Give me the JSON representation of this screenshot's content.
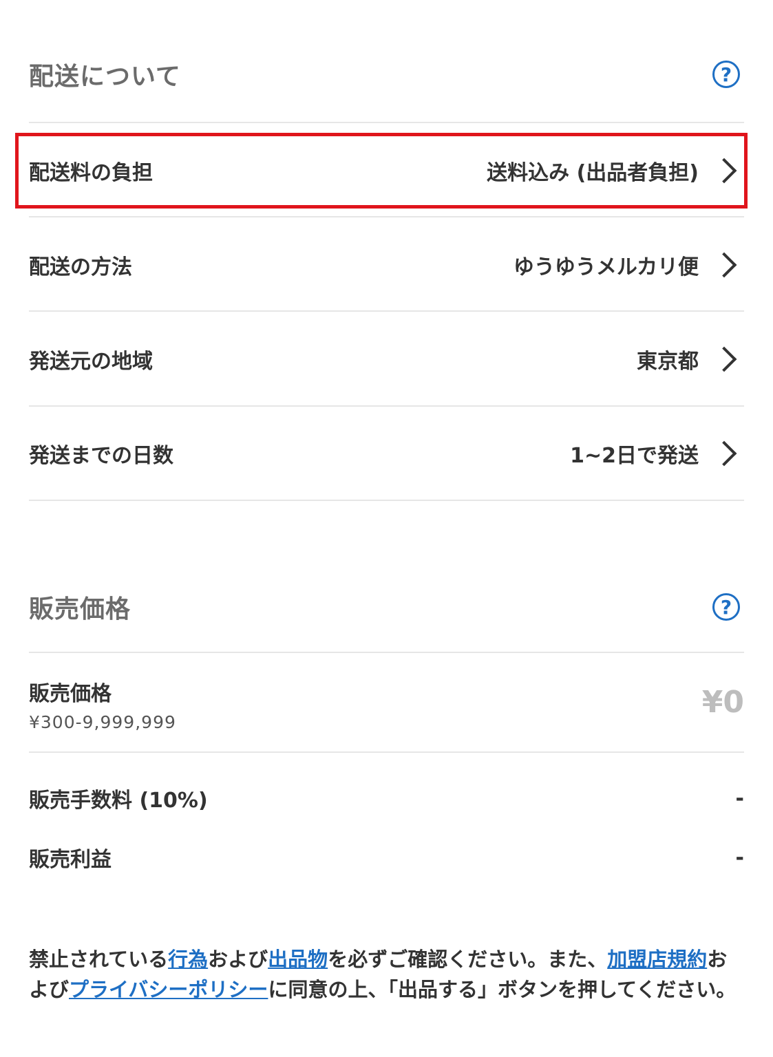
{
  "shipping": {
    "title": "配送について",
    "help_icon": "?",
    "rows": [
      {
        "label": "配送料の負担",
        "value": "送料込み (出品者負担)"
      },
      {
        "label": "配送の方法",
        "value": "ゆうゆうメルカリ便"
      },
      {
        "label": "発送元の地域",
        "value": "東京都"
      },
      {
        "label": "発送までの日数",
        "value": "1~2日で発送"
      }
    ]
  },
  "price": {
    "title": "販売価格",
    "help_icon": "?",
    "label": "販売価格",
    "range": "¥300-9,999,999",
    "value": "¥0",
    "fee_label": "販売手数料 (10%)",
    "fee_value": "-",
    "profit_label": "販売利益",
    "profit_value": "-"
  },
  "notice": {
    "t1": "禁止されている",
    "link1": "行為",
    "t2": "および",
    "link2": "出品物",
    "t3": "を必ずご確認ください。また、",
    "link3": "加盟店規約",
    "t4": "および",
    "link4": "プライバシーポリシー",
    "t5": "に同意の上、「出品する」ボタンを押してください。"
  },
  "colors": {
    "accent": "#1e6fc4",
    "highlight": "#e0151c"
  }
}
